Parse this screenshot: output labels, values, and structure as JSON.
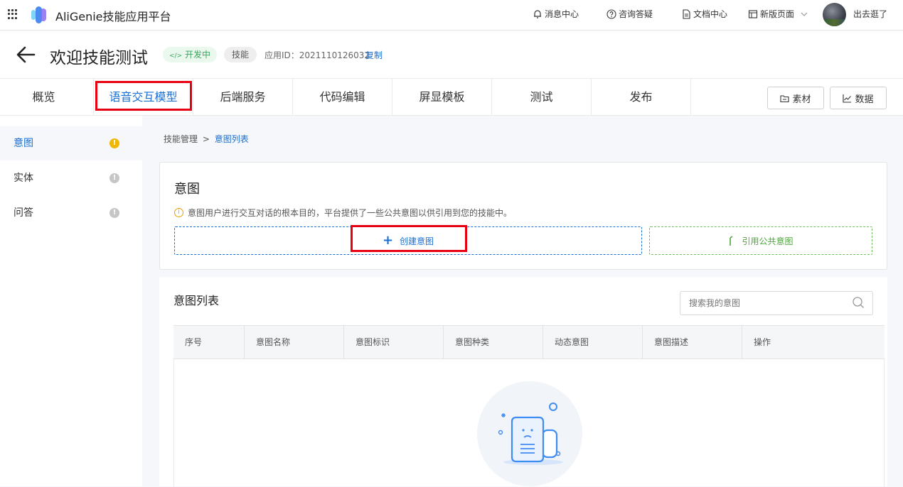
{
  "topbar": {
    "brand": "AliGenie技能应用平台",
    "nav": [
      "消息中心",
      "咨询答疑",
      "文档中心",
      "新版页面"
    ],
    "user_name": "出去逛了"
  },
  "header": {
    "title": "欢迎技能测试",
    "status": "开发中",
    "status_prefix": "</>",
    "type": "技能",
    "app_id": "应用ID：2021110126032",
    "copy": "复制"
  },
  "tabs": [
    "概览",
    "语音交互模型",
    "后端服务",
    "代码编辑",
    "屏显模板",
    "测试",
    "发布"
  ],
  "toolbar": {
    "assets": "素材",
    "data": "数据"
  },
  "sidebar": {
    "items": [
      {
        "label": "意图",
        "badge": "!",
        "badge_color": "#f2b705"
      },
      {
        "label": "实体",
        "badge": "!",
        "badge_color": "#c6c6c6"
      },
      {
        "label": "问答",
        "badge": "!",
        "badge_color": "#c6c6c6"
      }
    ]
  },
  "breadcrumb": {
    "parent": "技能管理",
    "separator": ">",
    "current": "意图列表"
  },
  "intent_panel": {
    "title": "意图",
    "info_icon": "i",
    "info": "意图用户进行交互对话的根本目的，平台提供了一些公共意图以供引用到您的技能中。",
    "create_plus": "+",
    "create_label": "创建意图",
    "ref_label": "引用公共意图"
  },
  "list": {
    "title": "意图列表",
    "search_placeholder": "搜索我的意图",
    "columns": [
      "序号",
      "意图名称",
      "意图标识",
      "意图种类",
      "动态意图",
      "意图描述",
      "操作"
    ]
  },
  "colors": {
    "accent": "#1a6fd1",
    "highlight": "#e60012",
    "success": "#3aa55b"
  }
}
